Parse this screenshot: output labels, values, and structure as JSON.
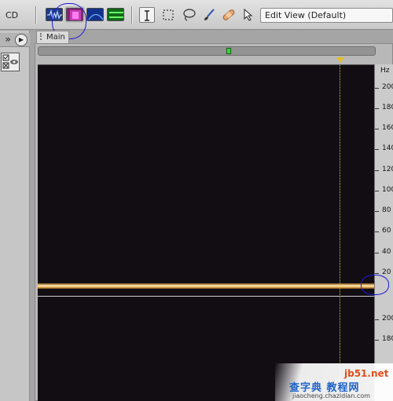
{
  "app": {
    "workspace_title": "CD",
    "edit_view_select": "Edit View (Default)"
  },
  "toolbar": {
    "view_buttons": [
      {
        "name": "waveform-view",
        "color": "#1f3b86",
        "active": false
      },
      {
        "name": "spectral-frequency-view",
        "color": "#8a1f7a",
        "active": true
      },
      {
        "name": "spectral-pan-view",
        "color": "#11328a",
        "active": false
      },
      {
        "name": "spectral-phase-view",
        "color": "#0f6a16",
        "active": false
      }
    ],
    "tools": [
      "time-selection-tool",
      "marquee-selection-tool",
      "lasso-selection-tool",
      "brush-selection-tool",
      "spot-healing-brush-tool",
      "move-tool"
    ]
  },
  "left_panel": {
    "checkbox_label": "☑\n☒"
  },
  "editor": {
    "tab_label": "Main",
    "ruler_unit": "Hz",
    "freq_labels_partial": [
      "200",
      "180",
      "160",
      "140",
      "120",
      "100",
      "80",
      "60",
      "40",
      "20",
      "200",
      "180"
    ]
  },
  "colors": {
    "spectral_background": "#120d12",
    "tone_highlight": "#ffe9b4",
    "annotation_circle": "#1a1ad8",
    "playhead": "#d7c64a"
  },
  "watermark": {
    "domain": "jb51.net",
    "title": "查字典 教程网",
    "subtitle": "jiaocheng.chazidian.com"
  }
}
